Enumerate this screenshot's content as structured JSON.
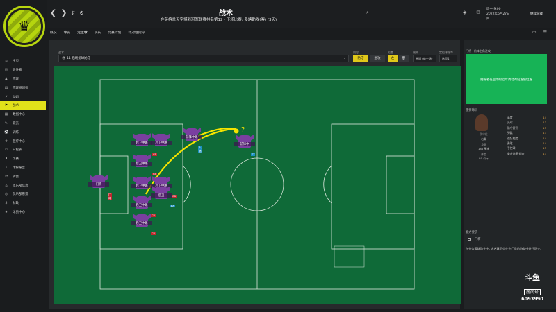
{
  "header": {
    "title": "战术",
    "subtitle": "在英格兰天空博彩冠军联赛排名第12 · 下场比赛: 多塘助攻(客) (3天)",
    "date_line1": "周一 9:00",
    "date_line2": "2022年6月27日",
    "date_line3": "目",
    "continue_label": "继续游戏"
  },
  "sidebar": {
    "items": [
      {
        "label": "主页",
        "icon": "home-icon"
      },
      {
        "label": "收件箱",
        "icon": "inbox-icon"
      },
      {
        "label": "阵容",
        "icon": "squad-icon"
      },
      {
        "label": "阵容规划师",
        "icon": "planner-icon"
      },
      {
        "label": "动态",
        "icon": "dynamics-icon"
      },
      {
        "label": "战术",
        "icon": "tactics-icon",
        "active": true
      },
      {
        "label": "数据中心",
        "icon": "data-icon"
      },
      {
        "label": "职员",
        "icon": "staff-icon"
      },
      {
        "label": "训练",
        "icon": "training-icon"
      },
      {
        "label": "医疗中心",
        "icon": "medical-icon"
      },
      {
        "label": "日程表",
        "icon": "calendar-icon"
      },
      {
        "label": "比赛",
        "icon": "competition-icon"
      },
      {
        "label": "球探报告",
        "icon": "scouting-icon"
      },
      {
        "label": "转会",
        "icon": "transfer-icon"
      },
      {
        "label": "俱乐部信息",
        "icon": "club-icon"
      },
      {
        "label": "俱乐部愿景",
        "icon": "vision-icon"
      },
      {
        "label": "财政",
        "icon": "finance-icon"
      },
      {
        "label": "球员中心",
        "icon": "dev-icon"
      }
    ]
  },
  "tabs": [
    "概况",
    "球员",
    "定位球",
    "队长",
    "比赛计划",
    "针对性指令"
  ],
  "active_tab": "定位球",
  "controls": {
    "label_select": "战术",
    "selected": "11 后场角球防守",
    "label_content": "内容",
    "btn_defend": "防守",
    "btn_attack": "进攻",
    "label_position": "位置",
    "btn_left": "左",
    "label_rule": "规则",
    "rule_value": "普通 (每一场)",
    "label_instructions": "定位球指令",
    "instructions_value": "选项1"
  },
  "players": [
    {
      "name": "门将",
      "badge": "门将",
      "badge_type": "cb"
    },
    {
      "name": "后卫中路",
      "badge": "CB",
      "badge_type": "cb"
    },
    {
      "name": "后卫中路",
      "badge": "",
      "badge_type": ""
    },
    {
      "name": "后卫中路",
      "badge": "CB",
      "badge_type": "cb"
    },
    {
      "name": "后卫中路",
      "badge": "",
      "badge_type": ""
    },
    {
      "name": "后卫中路",
      "badge": "CB",
      "badge_type": "cb"
    },
    {
      "name": "后卫",
      "badge": "EA",
      "badge_type": "cd"
    },
    {
      "name": "后卫中路",
      "badge": "CB",
      "badge_type": "cb"
    },
    {
      "name": "后卫中路",
      "badge": "CB",
      "badge_type": "cb"
    },
    {
      "name": "前锋中路",
      "badge": "人墙",
      "badge_type": "cd"
    },
    {
      "name": "前锋中",
      "badge": "ST",
      "badge_type": "cd"
    }
  ],
  "pitch_marker": "?",
  "right_panel": {
    "section_title": "门将 · 前锋主角进攻",
    "green_text": "拍摄者在后场附近时调动的设置值位置",
    "player_section": "重要球员",
    "player_label": "防守位",
    "player_pos": "右脚",
    "player_height": "186 厘米",
    "player_weight": "80 公斤",
    "player_height_label": "身高",
    "player_weight_label": "体重",
    "stats": [
      {
        "name": "高度",
        "value": "14"
      },
      {
        "name": "头球",
        "value": "13"
      },
      {
        "name": "防守意识",
        "value": "15"
      },
      {
        "name": "弹跳",
        "value": "13"
      },
      {
        "name": "强壮程度",
        "value": "14"
      },
      {
        "name": "勇敢",
        "value": "14"
      },
      {
        "name": "手控球",
        "value": "15"
      },
      {
        "name": "拳击选择(倾向)",
        "value": "13"
      }
    ],
    "role_section": "能力要求",
    "role_name": "门将",
    "description": "在任务要球防守中, 这名球员会在守门员的协助中进行防守。"
  },
  "watermark": {
    "brand": "斗鱼",
    "sub": "房间号",
    "number": "6093990"
  }
}
